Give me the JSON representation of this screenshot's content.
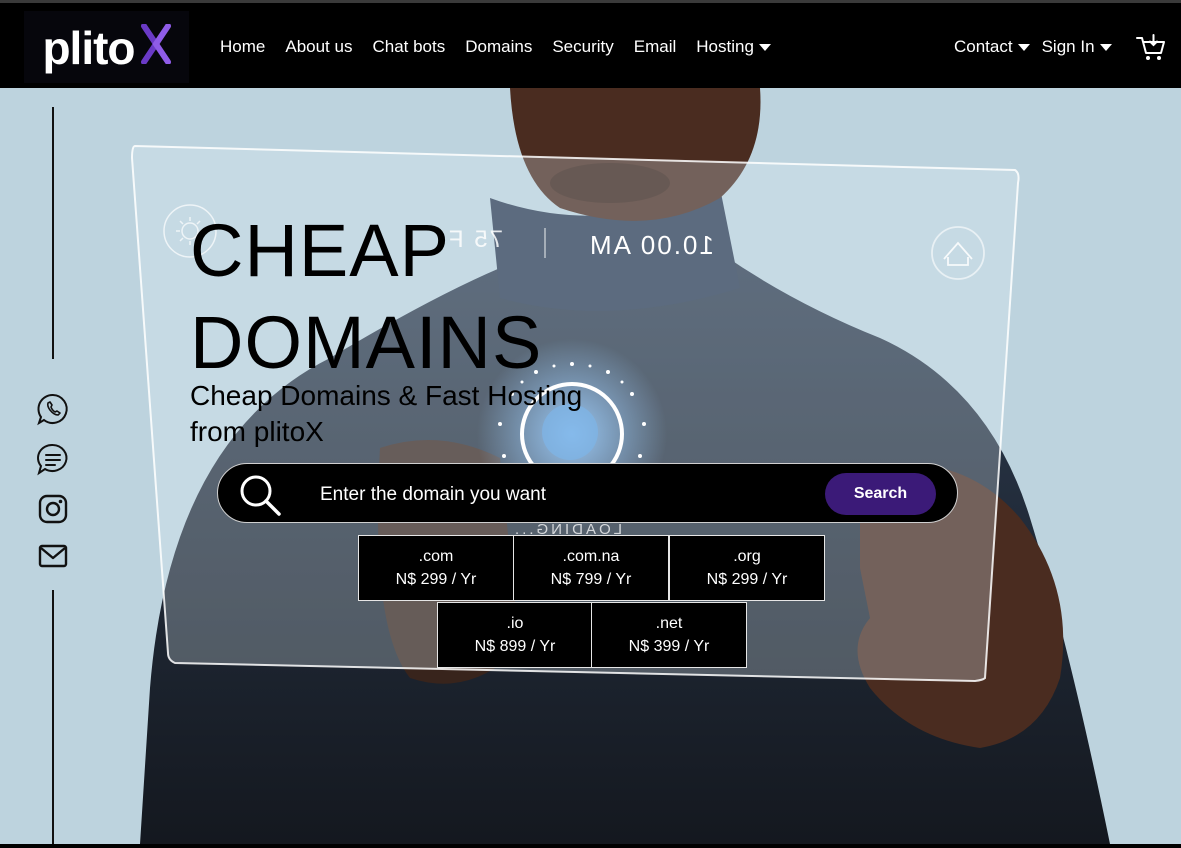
{
  "brand": {
    "name": "plito",
    "mark": "X",
    "accent": "#6a3ac6"
  },
  "nav": {
    "items": [
      {
        "label": "Home"
      },
      {
        "label": "About us"
      },
      {
        "label": "Chat bots"
      },
      {
        "label": "Domains"
      },
      {
        "label": "Security"
      },
      {
        "label": "Email"
      },
      {
        "label": "Hosting",
        "dropdown": true
      }
    ],
    "contact_label": "Contact",
    "signin_label": "Sign In",
    "cart_icon": "cart-icon"
  },
  "hero": {
    "title_line1": "CHEAP",
    "title_line2": "DOMAINS",
    "subtitle_line1": "Cheap Domains & Fast Hosting",
    "subtitle_line2": "from plitoX",
    "screen_time": "10.00 AM",
    "screen_temp": "75 F",
    "screen_loading": "LOADING..."
  },
  "search": {
    "placeholder": "Enter the domain you want",
    "button_label": "Search",
    "button_color": "#3b1a78"
  },
  "social": [
    "whatsapp-icon",
    "chat-icon",
    "instagram-icon",
    "mail-icon"
  ],
  "tlds": [
    {
      "ext": ".com",
      "price": "N$ 299 / Yr"
    },
    {
      "ext": ".com.na",
      "price": "N$ 799 / Yr"
    },
    {
      "ext": ".org",
      "price": "N$ 299 / Yr"
    },
    {
      "ext": ".io",
      "price": "N$ 899 / Yr"
    },
    {
      "ext": ".net",
      "price": "N$ 399 / Yr"
    }
  ]
}
